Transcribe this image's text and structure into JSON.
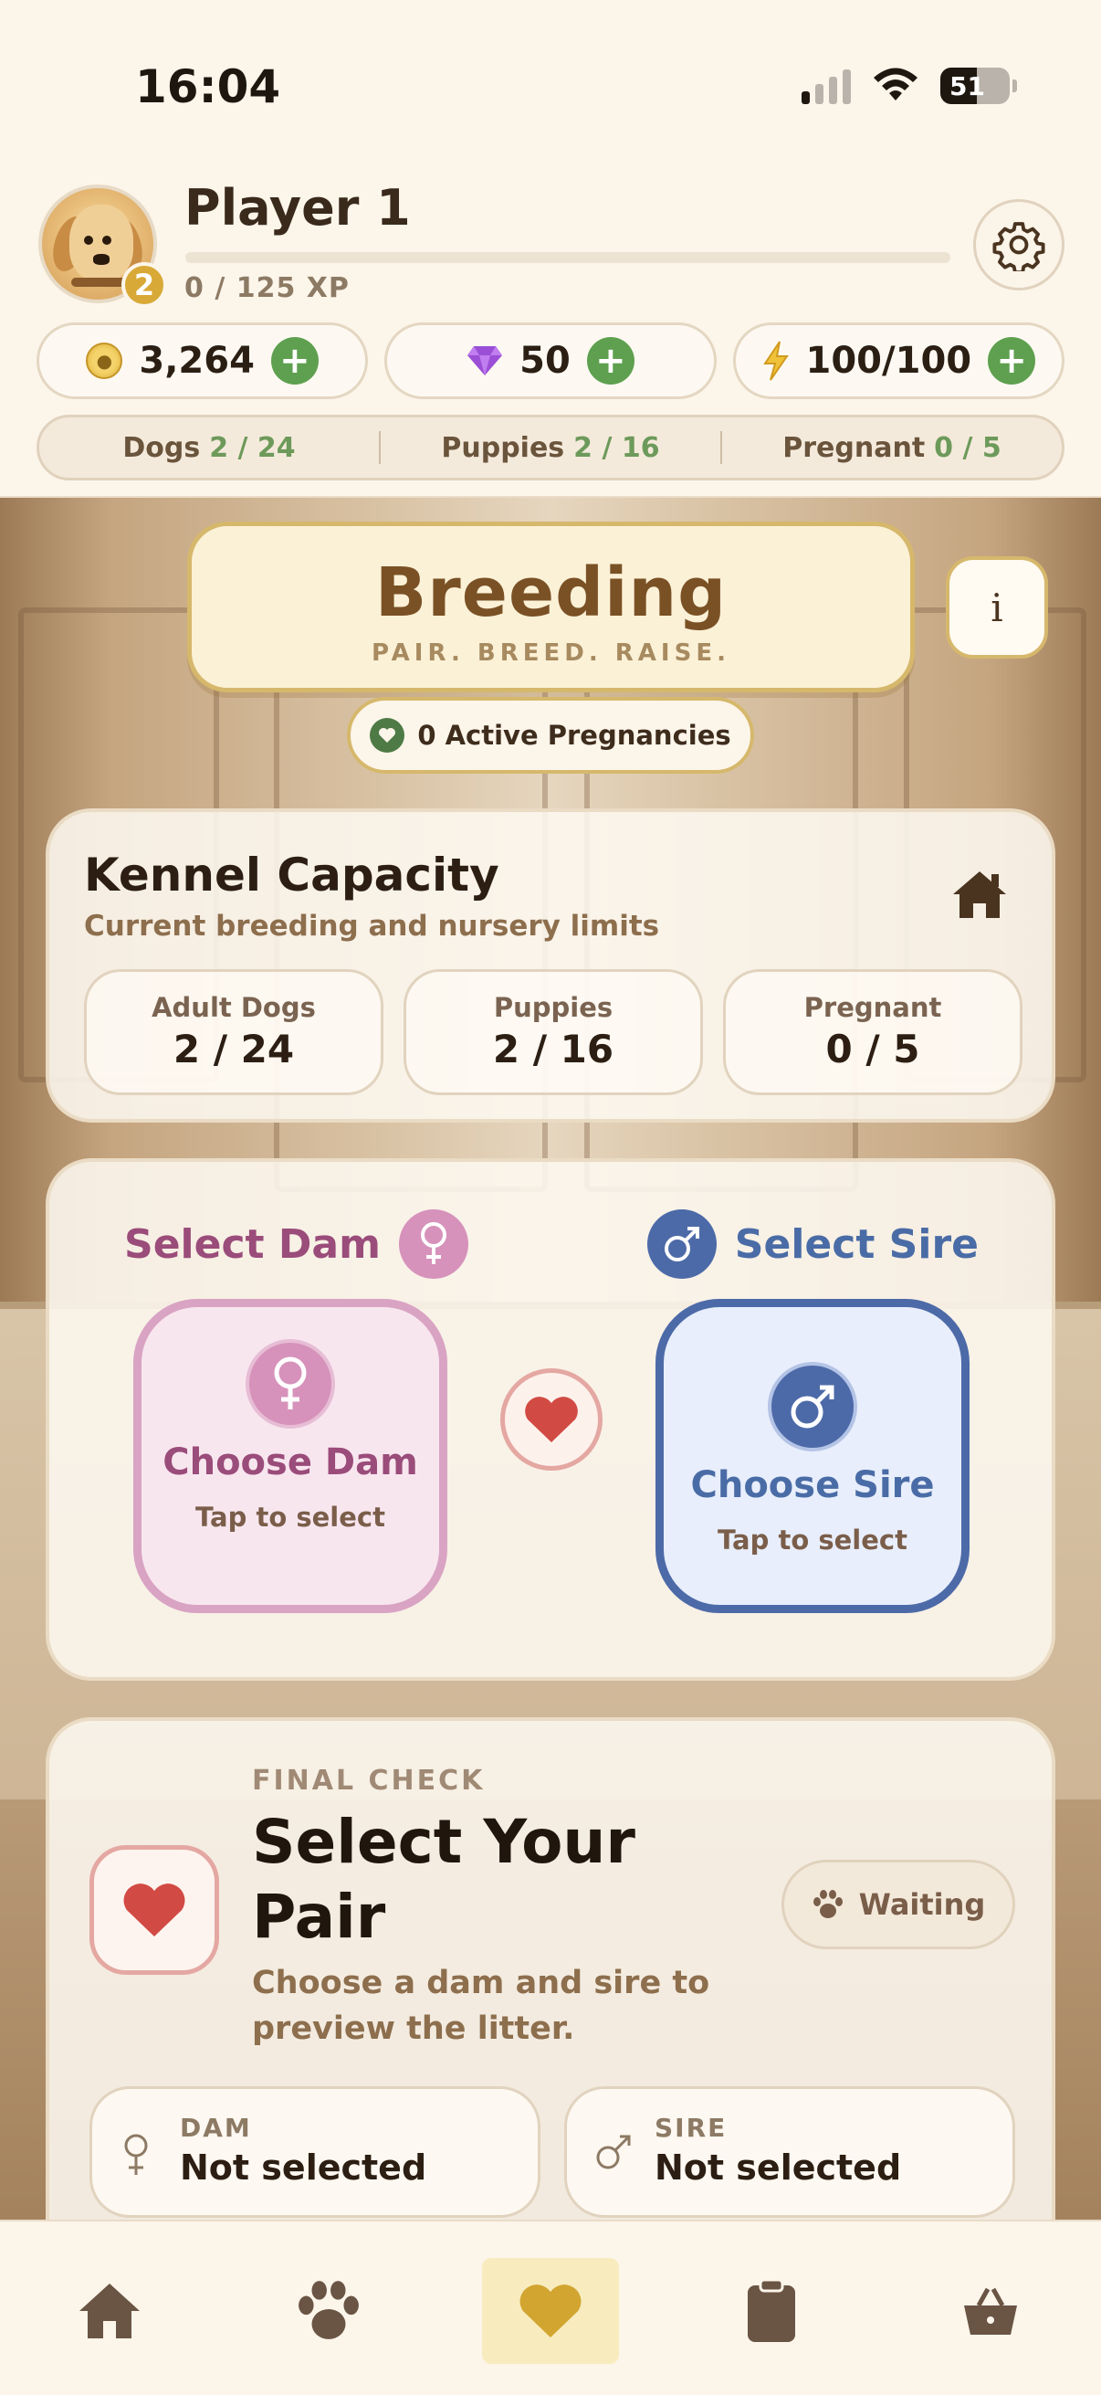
{
  "status_bar": {
    "time": "16:04",
    "battery": "51"
  },
  "player": {
    "name": "Player 1",
    "level": "2",
    "xp_text": "0 / 125 XP",
    "xp_progress": 0
  },
  "currencies": [
    {
      "icon": "paw-coin-icon",
      "value": "3,264"
    },
    {
      "icon": "gem-icon",
      "value": "50"
    },
    {
      "icon": "energy-bolt-icon",
      "value": "100/100"
    }
  ],
  "stats": [
    {
      "label": "Dogs",
      "value": "2 / 24"
    },
    {
      "label": "Puppies",
      "value": "2 / 16"
    },
    {
      "label": "Pregnant",
      "value": "0 / 5"
    }
  ],
  "header": {
    "title": "Breeding",
    "subtitle": "PAIR. BREED. RAISE.",
    "info_label": "i",
    "pregnancies": "0 Active Pregnancies"
  },
  "kennel": {
    "title": "Kennel Capacity",
    "description": "Current breeding and nursery limits",
    "boxes": [
      {
        "label": "Adult Dogs",
        "value": "2 / 24"
      },
      {
        "label": "Puppies",
        "value": "2 / 16"
      },
      {
        "label": "Pregnant",
        "value": "0 / 5"
      }
    ]
  },
  "pairing": {
    "select_dam": "Select Dam",
    "select_sire": "Select Sire",
    "dam_slot": {
      "title": "Choose Dam",
      "hint": "Tap to select"
    },
    "sire_slot": {
      "title": "Choose Sire",
      "hint": "Tap to select"
    }
  },
  "final_check": {
    "eyebrow": "FINAL CHECK",
    "title": "Select Your Pair",
    "description": "Choose a dam and sire to preview the litter.",
    "status": "Waiting",
    "dam_label": "DAM",
    "dam_value": "Not selected",
    "sire_label": "SIRE",
    "sire_value": "Not selected"
  },
  "nav": [
    {
      "icon": "home-icon",
      "active": false
    },
    {
      "icon": "paw-icon",
      "active": false
    },
    {
      "icon": "heart-icon",
      "active": true
    },
    {
      "icon": "clipboard-icon",
      "active": false
    },
    {
      "icon": "basket-icon",
      "active": false
    }
  ],
  "colors": {
    "accent_gold": "#d8a936",
    "dam_pink": "#9a4c7a",
    "sire_blue": "#4a6ca6",
    "heart_red": "#d24a44",
    "positive_green": "#5ea04f"
  }
}
